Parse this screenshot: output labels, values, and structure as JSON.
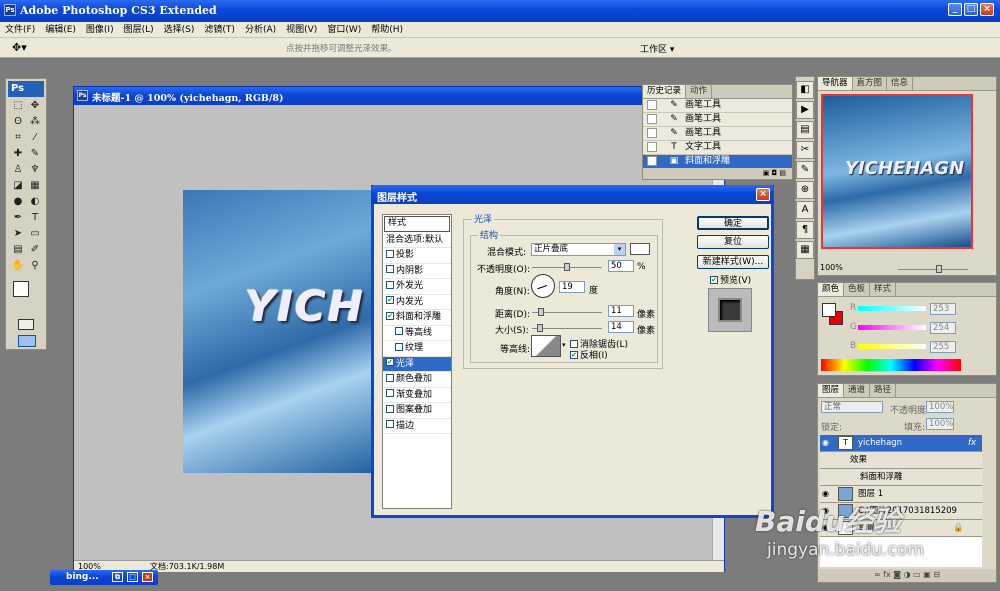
{
  "app": {
    "title": "Adobe Photoshop CS3 Extended",
    "window_controls": {
      "minimize": "_",
      "maximize": "□",
      "close": "×"
    }
  },
  "menu": [
    "文件(F)",
    "编辑(E)",
    "图像(I)",
    "图层(L)",
    "选择(S)",
    "滤镜(T)",
    "分析(A)",
    "视图(V)",
    "窗口(W)",
    "帮助(H)"
  ],
  "options_bar": {
    "hint": "点按并拖移可调整光泽效果。",
    "workspace": "工作区 ▾",
    "tool_icon": "move-tool-icon"
  },
  "document": {
    "title": "未标题-1 @ 100% (yichehagn, RGB/8)",
    "canvas_text": "YICH",
    "zoom": "100%",
    "doc_info": "文档:703.1K/1.98M"
  },
  "taskbar_item": "bing...",
  "history": {
    "tabs": [
      "历史记录",
      "动作"
    ],
    "items": [
      "画笔工具",
      "画笔工具",
      "画笔工具",
      "文字工具",
      "斜面和浮雕"
    ]
  },
  "navigator": {
    "tabs": [
      "导航器",
      "直方图",
      "信息"
    ],
    "preview_text": "YICHEHAGN",
    "zoom": "100%"
  },
  "color_panel": {
    "tabs": [
      "颜色",
      "色板",
      "样式"
    ],
    "channels": [
      {
        "label": "R",
        "value": "253"
      },
      {
        "label": "G",
        "value": "254"
      },
      {
        "label": "B",
        "value": "255"
      }
    ],
    "fg": "#ffffff",
    "bg": "#e80000"
  },
  "layers": {
    "tabs": [
      "图层",
      "通道",
      "路径"
    ],
    "blend_mode": "正常",
    "opacity_label": "不透明度:",
    "opacity": "100%",
    "lock_label": "锁定:",
    "fill_label": "填充:",
    "fill": "100%",
    "rows": [
      {
        "name": "yichehagn",
        "badge": "fx"
      },
      {
        "name": "效果"
      },
      {
        "name": "斜面和浮雕"
      },
      {
        "name": "图层 1"
      },
      {
        "name": "C:\\图片2017031815209"
      },
      {
        "name": "背景"
      }
    ]
  },
  "dialog": {
    "title": "图层样式",
    "left": {
      "header": "样式",
      "blend": "混合选项:默认",
      "items": [
        {
          "label": "投影",
          "checked": false
        },
        {
          "label": "内阴影",
          "checked": false
        },
        {
          "label": "外发光",
          "checked": false
        },
        {
          "label": "内发光",
          "checked": true
        },
        {
          "label": "斜面和浮雕",
          "checked": true
        },
        {
          "label": "等高线",
          "checked": false
        },
        {
          "label": "纹理",
          "checked": false
        },
        {
          "label": "光泽",
          "checked": true
        },
        {
          "label": "颜色叠加",
          "checked": false
        },
        {
          "label": "渐变叠加",
          "checked": false
        },
        {
          "label": "图案叠加",
          "checked": false
        },
        {
          "label": "描边",
          "checked": false
        }
      ]
    },
    "section": "光泽",
    "subsection": "结构",
    "blend_mode_label": "混合模式:",
    "blend_mode": "正片叠底",
    "opacity_label": "不透明度(O):",
    "opacity": "50",
    "percent": "%",
    "angle_label": "角度(N):",
    "angle": "19",
    "degree": "度",
    "distance_label": "距离(D):",
    "distance": "11",
    "size_label": "大小(S):",
    "size": "14",
    "pixel": "像素",
    "contour_label": "等高线:",
    "antialias": "消除锯齿(L)",
    "invert": "反相(I)",
    "buttons": {
      "ok": "确定",
      "reset": "复位",
      "new_style": "新建样式(W)...",
      "preview": "预览(V)"
    }
  },
  "watermark": {
    "text": "Baidu经验",
    "url": "jingyan.baidu.com"
  }
}
